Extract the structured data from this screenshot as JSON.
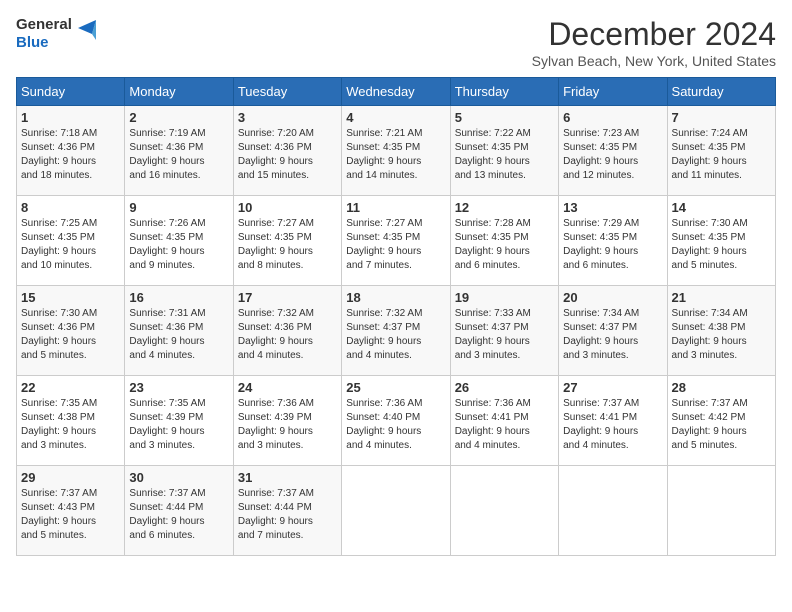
{
  "logo": {
    "text_general": "General",
    "text_blue": "Blue"
  },
  "title": "December 2024",
  "subtitle": "Sylvan Beach, New York, United States",
  "days_of_week": [
    "Sunday",
    "Monday",
    "Tuesday",
    "Wednesday",
    "Thursday",
    "Friday",
    "Saturday"
  ],
  "weeks": [
    [
      {
        "day": "1",
        "info": "Sunrise: 7:18 AM\nSunset: 4:36 PM\nDaylight: 9 hours\nand 18 minutes."
      },
      {
        "day": "2",
        "info": "Sunrise: 7:19 AM\nSunset: 4:36 PM\nDaylight: 9 hours\nand 16 minutes."
      },
      {
        "day": "3",
        "info": "Sunrise: 7:20 AM\nSunset: 4:36 PM\nDaylight: 9 hours\nand 15 minutes."
      },
      {
        "day": "4",
        "info": "Sunrise: 7:21 AM\nSunset: 4:35 PM\nDaylight: 9 hours\nand 14 minutes."
      },
      {
        "day": "5",
        "info": "Sunrise: 7:22 AM\nSunset: 4:35 PM\nDaylight: 9 hours\nand 13 minutes."
      },
      {
        "day": "6",
        "info": "Sunrise: 7:23 AM\nSunset: 4:35 PM\nDaylight: 9 hours\nand 12 minutes."
      },
      {
        "day": "7",
        "info": "Sunrise: 7:24 AM\nSunset: 4:35 PM\nDaylight: 9 hours\nand 11 minutes."
      }
    ],
    [
      {
        "day": "8",
        "info": "Sunrise: 7:25 AM\nSunset: 4:35 PM\nDaylight: 9 hours\nand 10 minutes."
      },
      {
        "day": "9",
        "info": "Sunrise: 7:26 AM\nSunset: 4:35 PM\nDaylight: 9 hours\nand 9 minutes."
      },
      {
        "day": "10",
        "info": "Sunrise: 7:27 AM\nSunset: 4:35 PM\nDaylight: 9 hours\nand 8 minutes."
      },
      {
        "day": "11",
        "info": "Sunrise: 7:27 AM\nSunset: 4:35 PM\nDaylight: 9 hours\nand 7 minutes."
      },
      {
        "day": "12",
        "info": "Sunrise: 7:28 AM\nSunset: 4:35 PM\nDaylight: 9 hours\nand 6 minutes."
      },
      {
        "day": "13",
        "info": "Sunrise: 7:29 AM\nSunset: 4:35 PM\nDaylight: 9 hours\nand 6 minutes."
      },
      {
        "day": "14",
        "info": "Sunrise: 7:30 AM\nSunset: 4:35 PM\nDaylight: 9 hours\nand 5 minutes."
      }
    ],
    [
      {
        "day": "15",
        "info": "Sunrise: 7:30 AM\nSunset: 4:36 PM\nDaylight: 9 hours\nand 5 minutes."
      },
      {
        "day": "16",
        "info": "Sunrise: 7:31 AM\nSunset: 4:36 PM\nDaylight: 9 hours\nand 4 minutes."
      },
      {
        "day": "17",
        "info": "Sunrise: 7:32 AM\nSunset: 4:36 PM\nDaylight: 9 hours\nand 4 minutes."
      },
      {
        "day": "18",
        "info": "Sunrise: 7:32 AM\nSunset: 4:37 PM\nDaylight: 9 hours\nand 4 minutes."
      },
      {
        "day": "19",
        "info": "Sunrise: 7:33 AM\nSunset: 4:37 PM\nDaylight: 9 hours\nand 3 minutes."
      },
      {
        "day": "20",
        "info": "Sunrise: 7:34 AM\nSunset: 4:37 PM\nDaylight: 9 hours\nand 3 minutes."
      },
      {
        "day": "21",
        "info": "Sunrise: 7:34 AM\nSunset: 4:38 PM\nDaylight: 9 hours\nand 3 minutes."
      }
    ],
    [
      {
        "day": "22",
        "info": "Sunrise: 7:35 AM\nSunset: 4:38 PM\nDaylight: 9 hours\nand 3 minutes."
      },
      {
        "day": "23",
        "info": "Sunrise: 7:35 AM\nSunset: 4:39 PM\nDaylight: 9 hours\nand 3 minutes."
      },
      {
        "day": "24",
        "info": "Sunrise: 7:36 AM\nSunset: 4:39 PM\nDaylight: 9 hours\nand 3 minutes."
      },
      {
        "day": "25",
        "info": "Sunrise: 7:36 AM\nSunset: 4:40 PM\nDaylight: 9 hours\nand 4 minutes."
      },
      {
        "day": "26",
        "info": "Sunrise: 7:36 AM\nSunset: 4:41 PM\nDaylight: 9 hours\nand 4 minutes."
      },
      {
        "day": "27",
        "info": "Sunrise: 7:37 AM\nSunset: 4:41 PM\nDaylight: 9 hours\nand 4 minutes."
      },
      {
        "day": "28",
        "info": "Sunrise: 7:37 AM\nSunset: 4:42 PM\nDaylight: 9 hours\nand 5 minutes."
      }
    ],
    [
      {
        "day": "29",
        "info": "Sunrise: 7:37 AM\nSunset: 4:43 PM\nDaylight: 9 hours\nand 5 minutes."
      },
      {
        "day": "30",
        "info": "Sunrise: 7:37 AM\nSunset: 4:44 PM\nDaylight: 9 hours\nand 6 minutes."
      },
      {
        "day": "31",
        "info": "Sunrise: 7:37 AM\nSunset: 4:44 PM\nDaylight: 9 hours\nand 7 minutes."
      },
      {
        "day": "",
        "info": ""
      },
      {
        "day": "",
        "info": ""
      },
      {
        "day": "",
        "info": ""
      },
      {
        "day": "",
        "info": ""
      }
    ]
  ]
}
